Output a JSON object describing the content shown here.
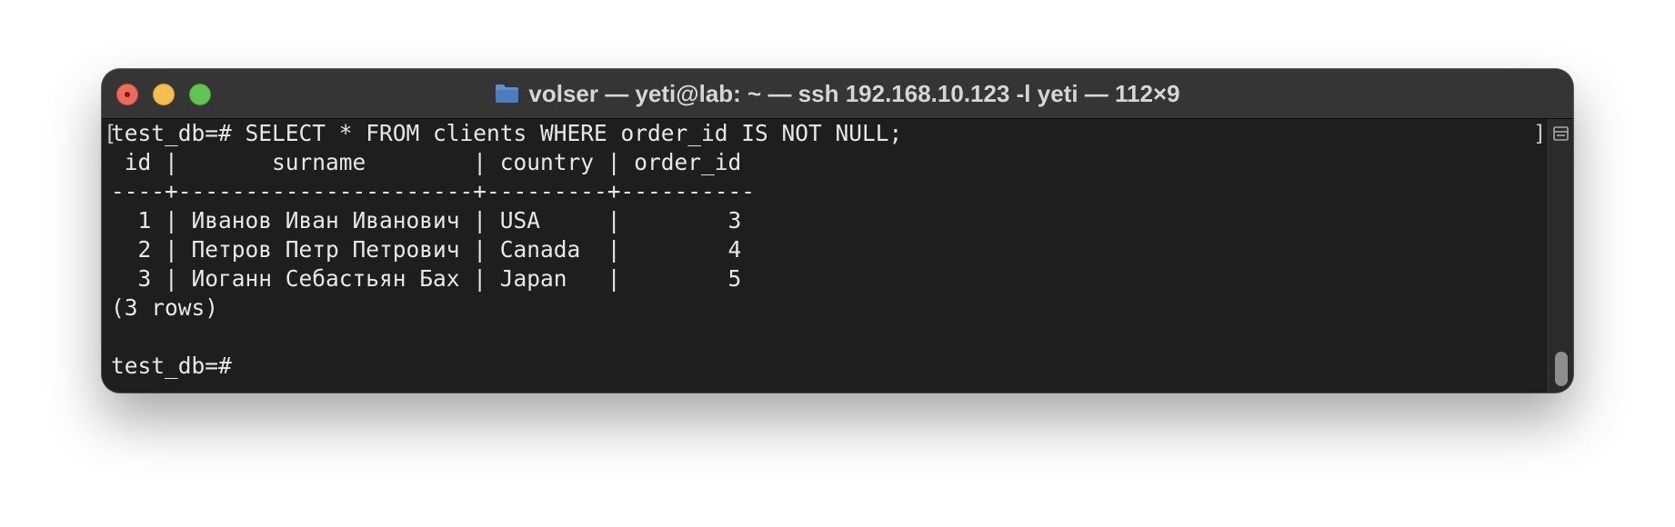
{
  "window": {
    "title": "volser — yeti@lab: ~ — ssh 192.168.10.123 -l yeti — 112×9",
    "title_icon": "folder-icon",
    "controls": [
      "close",
      "minimize",
      "zoom"
    ],
    "colors": {
      "close": "#ed6a5e",
      "minimize": "#f4bf4f",
      "zoom": "#61c554",
      "titlebar": "#353535",
      "terminal_bg": "#1e1e1e",
      "terminal_fg": "#e8e8e8"
    }
  },
  "terminal": {
    "lines": [
      "test_db=# SELECT * FROM clients WHERE order_id IS NOT NULL;",
      " id |       surname        | country | order_id",
      "----+----------------------+---------+----------",
      "  1 | Иванов Иван Иванович | USA     |        3",
      "  2 | Петров Петр Петрович | Canada  |        4",
      "  3 | Иоганн Себастьян Бах | Japan   |        5",
      "(3 rows)",
      "",
      "test_db=#"
    ],
    "mark_left": "[",
    "mark_right": "]"
  },
  "scrollbar": {
    "split_icon": "split-pane-icon"
  }
}
